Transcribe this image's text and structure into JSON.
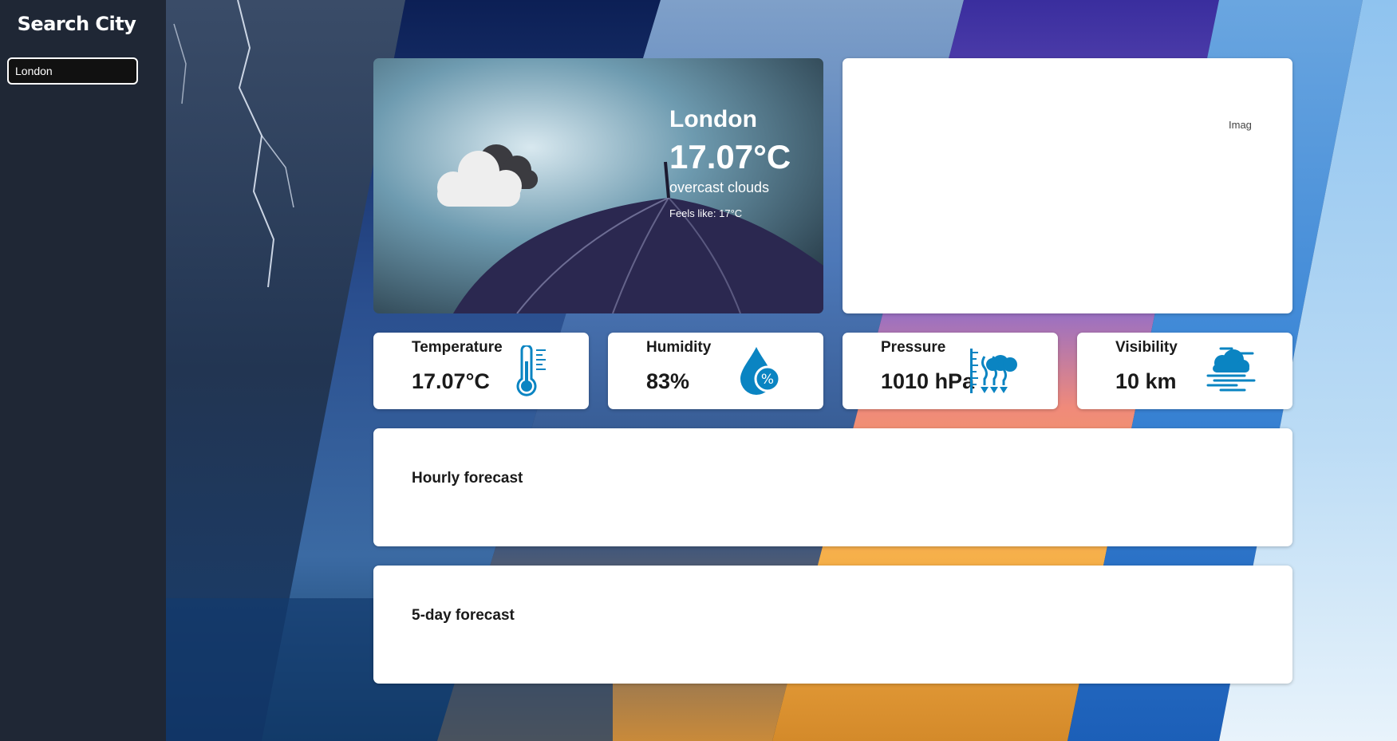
{
  "sidebar": {
    "title": "Search City",
    "search_value": "London"
  },
  "current": {
    "city": "London",
    "temperature": "17.07°C",
    "description": "overcast clouds",
    "feels_like": "Feels like: 17°C",
    "icon": "overcast-clouds-icon"
  },
  "map_image": {
    "alt_text": "Imag"
  },
  "stats": [
    {
      "label": "Temperature",
      "value": "17.07°C",
      "icon": "thermometer-icon"
    },
    {
      "label": "Humidity",
      "value": "83%",
      "icon": "humidity-drop-icon"
    },
    {
      "label": "Pressure",
      "value": "1010 hPa",
      "icon": "pressure-icon"
    },
    {
      "label": "Visibility",
      "value": "10 km",
      "icon": "visibility-fog-icon"
    }
  ],
  "hourly": {
    "title": "Hourly forecast"
  },
  "daily": {
    "title": "5-day forecast"
  },
  "colors": {
    "sidebar_bg": "#1f2735",
    "icon_blue": "#0a84c2",
    "card_bg": "#ffffff"
  }
}
